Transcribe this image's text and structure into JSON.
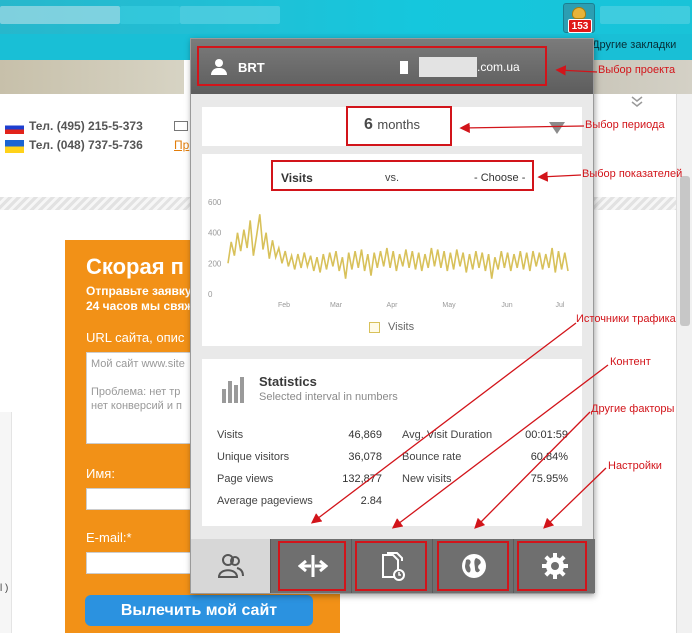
{
  "browser": {
    "extension_badge": "153",
    "bookmarks_label": "Другие закладки"
  },
  "site": {
    "phone_ru": "Тел. (495) 215-5-373",
    "phone_ua": "Тел. (048) 737-5-736",
    "link_partial": "Пр",
    "card_heading": "Скорая п",
    "card_line1": "Отправьте заявку",
    "card_line2": "24 часов мы свяж",
    "url_label": "URL сайта, опис",
    "textarea_placeholder_1": "Мой сайт www.site",
    "textarea_placeholder_2": "Проблема: нет тр",
    "textarea_placeholder_3": "нет конверсий и п",
    "name_label": "Имя:",
    "email_label": "E-mail:*",
    "cta_button": "Вылечить мой сайт",
    "left_mark": "l )"
  },
  "popup": {
    "header": {
      "project_name": "BRT",
      "domain_suffix": ".com.ua"
    },
    "period": {
      "value": "6",
      "unit": "months"
    },
    "metrics": {
      "primary": "Visits",
      "vs": "vs.",
      "secondary": "- Choose -"
    },
    "stats": {
      "title": "Statistics",
      "subtitle": "Selected interval in numbers",
      "left": [
        {
          "label": "Visits",
          "value": "46,869"
        },
        {
          "label": "Unique visitors",
          "value": "36,078"
        },
        {
          "label": "Page views",
          "value": "132,877"
        },
        {
          "label": "Average pageviews",
          "value": "2.84"
        }
      ],
      "right": [
        {
          "label": "Avg. Visit Duration",
          "value": "00:01:59"
        },
        {
          "label": "Bounce rate",
          "value": "60.84%"
        },
        {
          "label": "New visits",
          "value": "75.95%"
        }
      ]
    },
    "nav": [
      {
        "icon": "users-icon"
      },
      {
        "icon": "traffic-arrows-icon"
      },
      {
        "icon": "content-document-icon"
      },
      {
        "icon": "globe-icon"
      },
      {
        "icon": "gear-icon"
      }
    ]
  },
  "chart_data": {
    "type": "line",
    "title": "",
    "xlabel": "",
    "ylabel": "",
    "ylim": [
      0,
      600
    ],
    "yticks": [
      "600",
      "400",
      "200",
      "0"
    ],
    "x_tick_labels": [
      "Feb",
      "Mar",
      "Apr",
      "May",
      "Jun",
      "Jul"
    ],
    "legend": [
      "Visits"
    ],
    "series": [
      {
        "name": "Visits",
        "color": "#d8c15a",
        "values": [
          200,
          340,
          250,
          400,
          280,
          420,
          300,
          480,
          250,
          380,
          520,
          290,
          400,
          230,
          350,
          240,
          300,
          200,
          280,
          180,
          250,
          160,
          260,
          170,
          270,
          180,
          250,
          150,
          240,
          140,
          260,
          160,
          270,
          180,
          280,
          150,
          240,
          100,
          270,
          160,
          280,
          170,
          290,
          150,
          260,
          120,
          270,
          170,
          280,
          180,
          300,
          170,
          280,
          150,
          260,
          180,
          290,
          170,
          280,
          160,
          270,
          150,
          260,
          170,
          300,
          180,
          290,
          170,
          280,
          150,
          270,
          160,
          290,
          180,
          270,
          140,
          260,
          160,
          280,
          170,
          270,
          150,
          260,
          100,
          240,
          160,
          280,
          170,
          270,
          150,
          260,
          170,
          280,
          160,
          270,
          150,
          280,
          180,
          270,
          160,
          260,
          170,
          300,
          140,
          280,
          160,
          270,
          150
        ]
      }
    ]
  },
  "annotations": {
    "project": "Выбор проекта",
    "period": "Выбор периода",
    "metrics": "Выбор показателей",
    "traffic": "Источники трафика",
    "content": "Контент",
    "other": "Другие факторы",
    "settings": "Настройки"
  }
}
